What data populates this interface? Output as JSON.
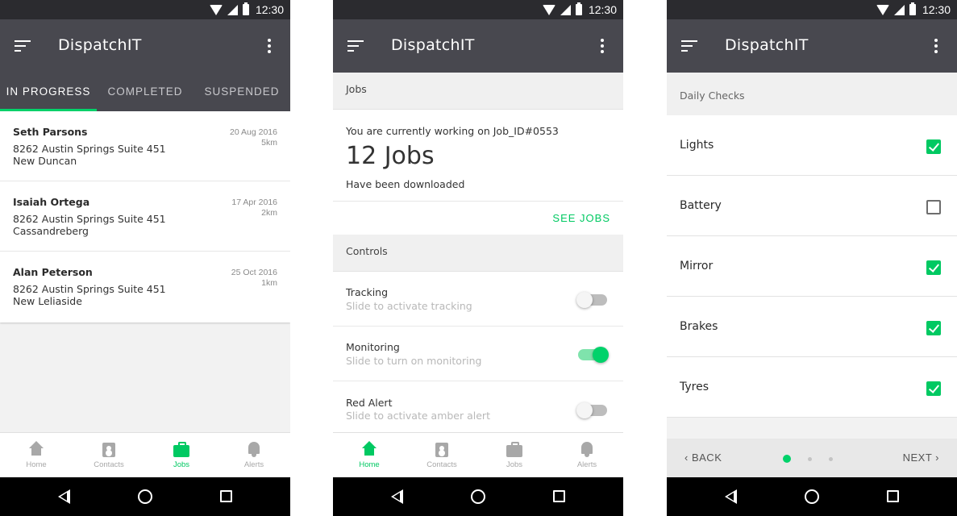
{
  "status_bar": {
    "time": "12:30"
  },
  "app": {
    "title": "DispatchIT"
  },
  "colors": {
    "accent": "#00d26a",
    "appbar": "#48484f",
    "statusbar": "#2b2b2f"
  },
  "screen1": {
    "tabs": [
      "IN PROGRESS",
      "COMPLETED",
      "SUSPENDED"
    ],
    "jobs": [
      {
        "name": "Seth Parsons",
        "address": "8262 Austin Springs Suite 451",
        "city": "New Duncan",
        "date": "20 Aug 2016",
        "distance": "5km"
      },
      {
        "name": "Isaiah Ortega",
        "address": "8262 Austin Springs Suite 451",
        "city": "Cassandreberg",
        "date": "17 Apr 2016",
        "distance": "2km"
      },
      {
        "name": "Alan Peterson",
        "address": "8262 Austin Springs Suite 451",
        "city": "New Leliaside",
        "date": "25 Oct 2016",
        "distance": "1km"
      }
    ],
    "nav": [
      "Home",
      "Contacts",
      "Jobs",
      "Alerts"
    ]
  },
  "screen2": {
    "jobs_header": "Jobs",
    "current_job": "You are currently working on Job_ID#0553",
    "count": "12 Jobs",
    "note": "Have been downloaded",
    "see_jobs": "SEE JOBS",
    "controls_header": "Controls",
    "controls": [
      {
        "title": "Tracking",
        "subtitle": "Slide to activate tracking",
        "on": false
      },
      {
        "title": "Monitoring",
        "subtitle": "Slide to turn on monitoring",
        "on": true
      },
      {
        "title": "Red Alert",
        "subtitle": "Slide to activate amber alert",
        "on": false
      }
    ],
    "nav": [
      "Home",
      "Contacts",
      "Jobs",
      "Alerts"
    ]
  },
  "screen3": {
    "header": "Daily Checks",
    "checks": [
      {
        "label": "Lights",
        "checked": true
      },
      {
        "label": "Battery",
        "checked": false
      },
      {
        "label": "Mirror",
        "checked": true
      },
      {
        "label": "Brakes",
        "checked": true
      },
      {
        "label": "Tyres",
        "checked": true
      }
    ],
    "back": "BACK",
    "next": "NEXT",
    "step": {
      "current": 1,
      "total": 3
    }
  },
  "icons": {
    "menu": "sort-menu-icon",
    "more": "more-vert-icon",
    "nav": [
      "home-icon",
      "contacts-icon",
      "briefcase-icon",
      "bell-icon"
    ],
    "system": [
      "back-triangle-icon",
      "home-circle-icon",
      "recents-square-icon"
    ]
  }
}
